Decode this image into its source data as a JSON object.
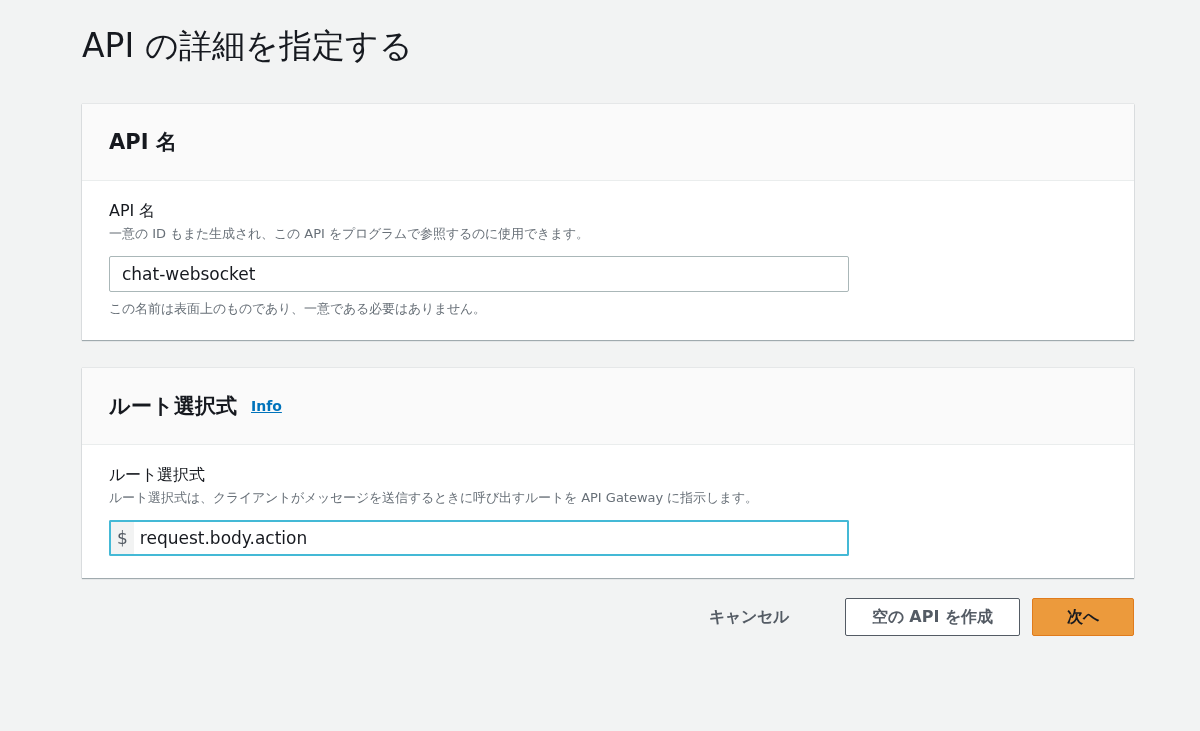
{
  "page_title": "API の詳細を指定する",
  "panels": [
    {
      "title": "API 名",
      "field": {
        "label": "API 名",
        "description": "一意の ID もまた生成され、この API をプログラムで参照するのに使用できます。",
        "value": "chat-websocket",
        "focused": false,
        "hint": "この名前は表面上のものであり、一意である必要はありません。"
      }
    },
    {
      "title": "ルート選択式",
      "info_link": "Info",
      "field": {
        "label": "ルート選択式",
        "description": "ルート選択式は、クライアントがメッセージを送信するときに呼び出すルートを API Gateway に指示します。",
        "prefix": "$",
        "value": "request.body.action",
        "focused": true
      }
    }
  ],
  "buttons": [
    {
      "label": "キャンセル",
      "kind": "link"
    },
    {
      "label": "空の API を作成",
      "kind": "secondary"
    },
    {
      "label": "次へ",
      "kind": "primary"
    }
  ]
}
